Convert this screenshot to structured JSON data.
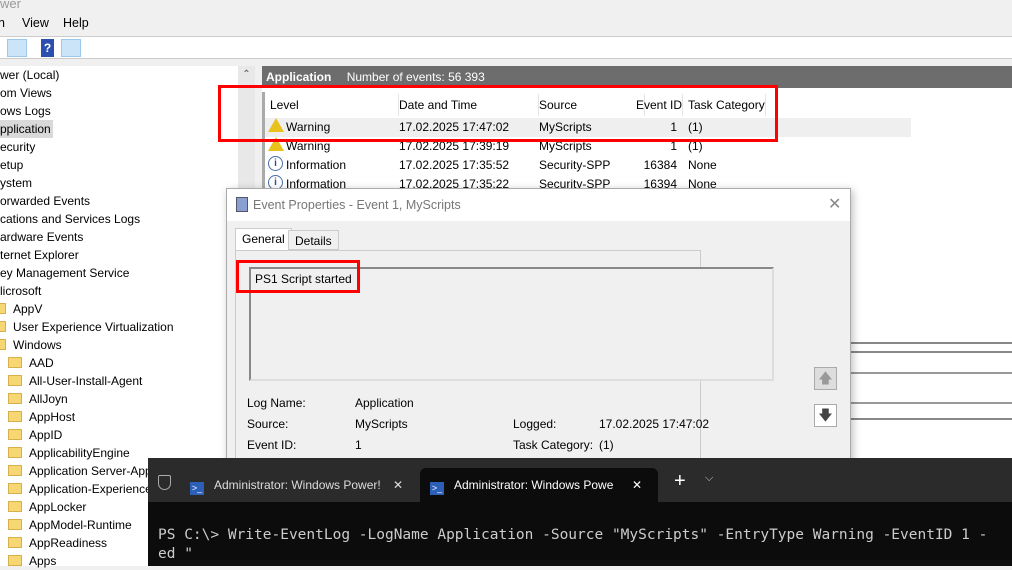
{
  "window": {
    "title_fragment": "wer"
  },
  "menu": {
    "items": [
      "n",
      "View",
      "Help"
    ]
  },
  "tree": {
    "items": [
      "wer (Local)",
      "om Views",
      "ows Logs",
      "pplication",
      "ecurity",
      "etup",
      "ystem",
      "orwarded Events",
      "cations and Services Logs",
      "ardware Events",
      "ternet Explorer",
      "ey Management Service",
      "licrosoft"
    ],
    "microsoft_children": [
      "AppV",
      "User Experience Virtualization",
      "Windows"
    ],
    "windows_children": [
      "AAD",
      "All-User-Install-Agent",
      "AllJoyn",
      "AppHost",
      "AppID",
      "ApplicabilityEngine",
      "Application Server-App",
      "Application-Experience",
      "AppLocker",
      "AppModel-Runtime",
      "AppReadiness",
      "Apps"
    ]
  },
  "events": {
    "title": "Application",
    "count_label": "Number of events: 56 393",
    "columns": [
      "Level",
      "Date and Time",
      "Source",
      "Event ID",
      "Task Category"
    ],
    "rows": [
      {
        "level": "Warning",
        "icon": "warning-icon",
        "date": "17.02.2025 17:47:02",
        "source": "MyScripts",
        "id": "1",
        "cat": "(1)"
      },
      {
        "level": "Warning",
        "icon": "warning-icon",
        "date": "17.02.2025 17:39:19",
        "source": "MyScripts",
        "id": "1",
        "cat": "(1)"
      },
      {
        "level": "Information",
        "icon": "info-icon",
        "date": "17.02.2025 17:35:52",
        "source": "Security-SPP",
        "id": "16384",
        "cat": "None"
      },
      {
        "level": "Information",
        "icon": "info-icon",
        "date": "17.02.2025 17:35:22",
        "source": "Security-SPP",
        "id": "16394",
        "cat": "None"
      }
    ]
  },
  "dialog": {
    "title": "Event Properties - Event 1, MyScripts",
    "tabs": [
      "General",
      "Details"
    ],
    "message": "PS1 Script started",
    "fields": {
      "log_name_label": "Log Name:",
      "log_name": "Application",
      "source_label": "Source:",
      "source": "MyScripts",
      "event_id_label": "Event ID:",
      "event_id": "1",
      "logged_label": "Logged:",
      "logged": "17.02.2025 17:47:02",
      "task_label": "Task Category:",
      "task": "(1)"
    }
  },
  "terminal": {
    "tabs": [
      "Administrator: Windows Power!",
      "Administrator: Windows Powe"
    ],
    "lines": [
      "PS C:\\> Write-EventLog -LogName Application -Source \"MyScripts\" -EntryType Warning -EventID 1 -",
      "ed \""
    ]
  },
  "colors": {
    "highlight": "#ff0000",
    "header_bar": "#6d6d6d",
    "terminal_bg": "#0c0c0c"
  }
}
